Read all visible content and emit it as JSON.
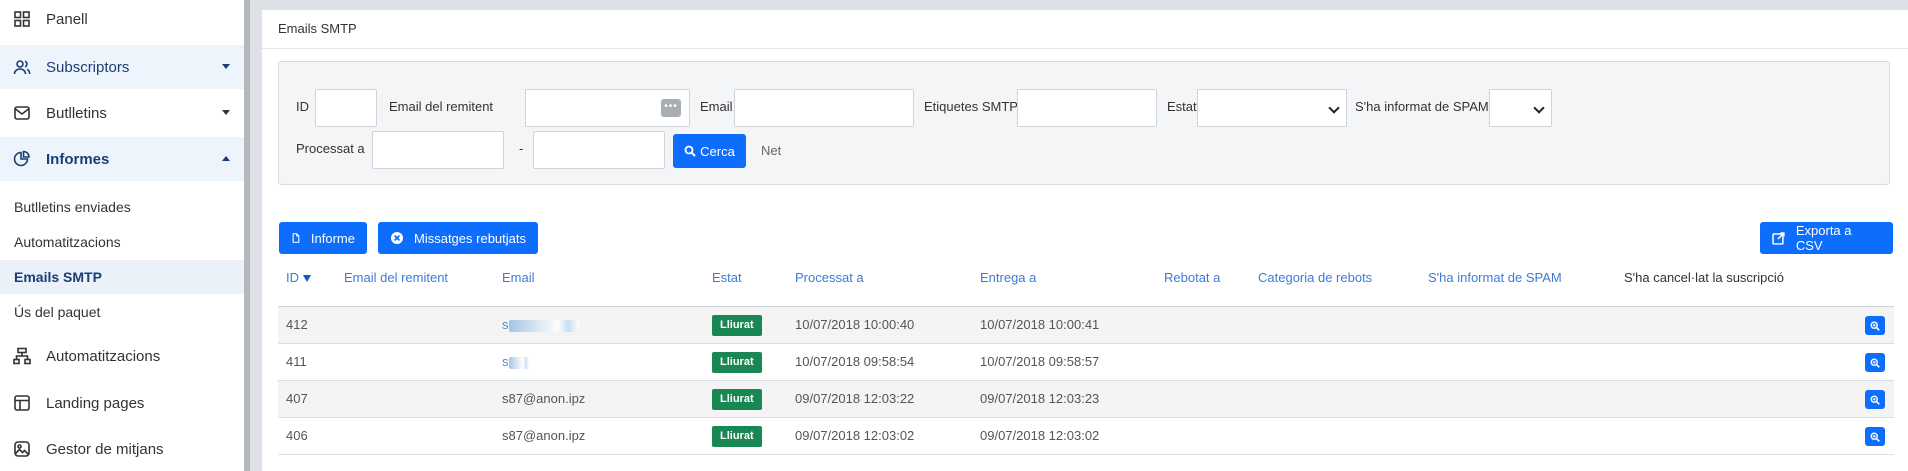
{
  "sidebar": {
    "items": [
      {
        "label": "Panell",
        "icon": "grid-icon"
      },
      {
        "label": "Subscriptors",
        "icon": "users-icon"
      },
      {
        "label": "Butlletins",
        "icon": "envelope-icon"
      },
      {
        "label": "Informes",
        "icon": "pie-chart-icon"
      },
      {
        "label": "Automatitzacions",
        "icon": "workflow-icon"
      },
      {
        "label": "Landing pages",
        "icon": "layout-icon"
      },
      {
        "label": "Gestor de mitjans",
        "icon": "image-icon"
      }
    ],
    "sub_items": [
      {
        "label": "Butlletins enviades"
      },
      {
        "label": "Automatitzacions"
      },
      {
        "label": "Emails SMTP"
      },
      {
        "label": "Ús del paquet"
      }
    ]
  },
  "card": {
    "title": "Emails SMTP"
  },
  "filters": {
    "id_label": "ID",
    "sender_label": "Email del remitent",
    "email_label": "Email",
    "tags_label": "Etiquetes SMTP",
    "status_label": "Estat",
    "spam_label": "S'ha informat de SPAM",
    "processed_label": "Processat a",
    "range_separator": "-",
    "search_label": "Cerca",
    "clear_label": "Net",
    "dots": "•••"
  },
  "actions": {
    "report_label": "Informe",
    "rejected_label": "Missatges rebutjats",
    "export_label": "Exporta a CSV"
  },
  "table": {
    "columns": [
      "ID",
      "Email del remitent",
      "Email",
      "Estat",
      "Processat a",
      "Entrega a",
      "Rebotat a",
      "Categoria de rebots",
      "S'ha informat de SPAM",
      "S'ha cancel·lat la suscripció"
    ],
    "rows": [
      {
        "id": "412",
        "sender": "",
        "email": "s",
        "status": "Lliurat",
        "processed": "10/07/2018 10:00:40",
        "delivered": "10/07/2018 10:00:41",
        "blurred": true
      },
      {
        "id": "411",
        "sender": "",
        "email": "s",
        "status": "Lliurat",
        "processed": "10/07/2018 09:58:54",
        "delivered": "10/07/2018 09:58:57",
        "blurred": true
      },
      {
        "id": "407",
        "sender": "",
        "email": "s87@anon.ipz",
        "status": "Lliurat",
        "processed": "09/07/2018 12:03:22",
        "delivered": "09/07/2018 12:03:23",
        "blurred": false
      },
      {
        "id": "406",
        "sender": "",
        "email": "s87@anon.ipz",
        "status": "Lliurat",
        "processed": "09/07/2018 12:03:02",
        "delivered": "09/07/2018 12:03:02",
        "blurred": false
      }
    ]
  },
  "colors": {
    "primary": "#0d6efd",
    "success": "#198754",
    "nav_active": "#1a3e76",
    "link": "#3e7bd6"
  }
}
